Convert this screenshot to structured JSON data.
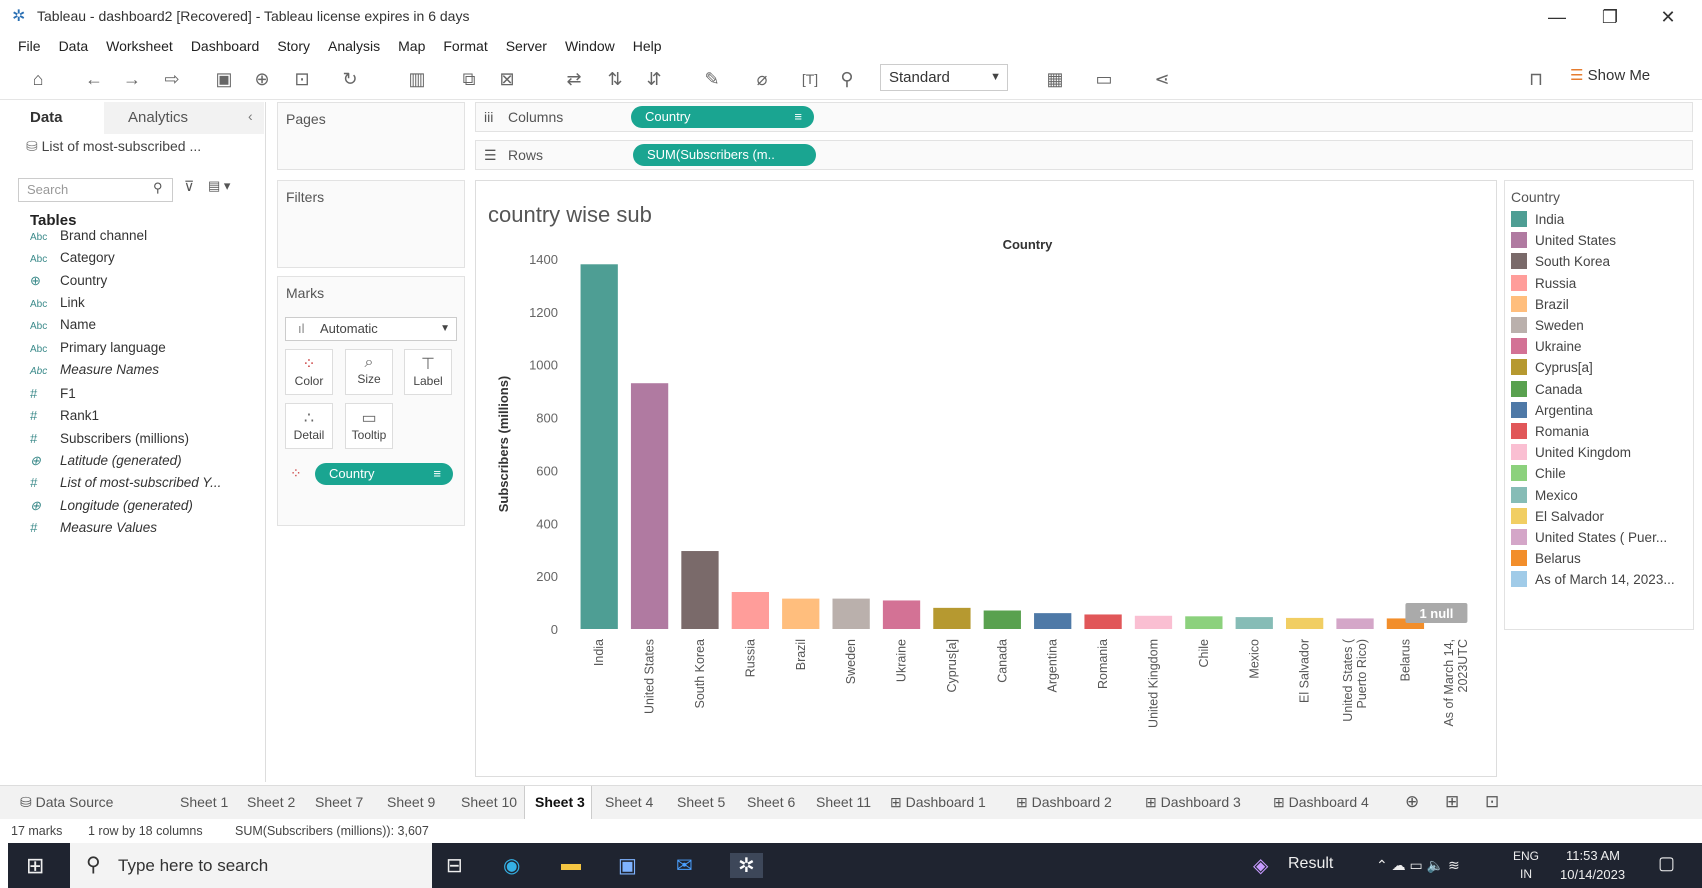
{
  "window": {
    "title": "Tableau - dashboard2 [Recovered] - Tableau license expires in 6 days"
  },
  "menu": [
    "File",
    "Data",
    "Worksheet",
    "Dashboard",
    "Story",
    "Analysis",
    "Map",
    "Format",
    "Server",
    "Window",
    "Help"
  ],
  "toolbar": {
    "fit": "Standard",
    "show_me": "Show Me"
  },
  "datapane": {
    "tab_data": "Data",
    "tab_analytics": "Analytics",
    "source": "List of most-subscribed ...",
    "search_placeholder": "Search",
    "tables_heading": "Tables",
    "fields": [
      {
        "ic": "Abc",
        "name": "Brand channel",
        "it": false
      },
      {
        "ic": "Abc",
        "name": "Category",
        "it": false
      },
      {
        "ic": "⊕",
        "name": "Country",
        "it": false
      },
      {
        "ic": "Abc",
        "name": "Link",
        "it": false
      },
      {
        "ic": "Abc",
        "name": "Name",
        "it": false
      },
      {
        "ic": "Abc",
        "name": "Primary language",
        "it": false
      },
      {
        "ic": "Abc",
        "name": "Measure Names",
        "it": true
      },
      {
        "ic": "#",
        "name": "F1",
        "it": false
      },
      {
        "ic": "#",
        "name": "Rank1",
        "it": false
      },
      {
        "ic": "#",
        "name": "Subscribers (millions)",
        "it": false
      },
      {
        "ic": "⊕",
        "name": "Latitude (generated)",
        "it": true
      },
      {
        "ic": "#",
        "name": "List of most-subscribed Y...",
        "it": true
      },
      {
        "ic": "⊕",
        "name": "Longitude (generated)",
        "it": true
      },
      {
        "ic": "#",
        "name": "Measure Values",
        "it": true
      }
    ]
  },
  "shelves": {
    "pages": "Pages",
    "filters": "Filters",
    "marks": "Marks",
    "mark_type": "Automatic",
    "btn_color": "Color",
    "btn_size": "Size",
    "btn_label": "Label",
    "btn_detail": "Detail",
    "btn_tooltip": "Tooltip",
    "marks_pill": "Country",
    "columns_label": "Columns",
    "rows_label": "Rows",
    "columns_pill": "Country",
    "rows_pill": "SUM(Subscribers (m.."
  },
  "chart_data": {
    "type": "bar",
    "title": "country wise sub",
    "xlabel": "Country",
    "ylabel": "Subscribers (millions)",
    "ylim": [
      0,
      1400
    ],
    "yticks": [
      0,
      200,
      400,
      600,
      800,
      1000,
      1200,
      1400
    ],
    "categories": [
      "India",
      "United States",
      "South Korea",
      "Russia",
      "Brazil",
      "Sweden",
      "Ukraine",
      "Cyprus[a]",
      "Canada",
      "Argentina",
      "Romania",
      "United Kingdom",
      "Chile",
      "Mexico",
      "El Salvador",
      "United States (\nPuerto Rico)",
      "Belarus",
      "As of March 14,\n2023UTC"
    ],
    "values": [
      1380,
      930,
      295,
      140,
      115,
      115,
      108,
      80,
      70,
      60,
      55,
      50,
      48,
      45,
      42,
      40,
      40,
      0
    ],
    "colors": [
      "#4e9e94",
      "#b07aa1",
      "#7a6a6a",
      "#ff9d9a",
      "#ffbe7d",
      "#bab0ac",
      "#d37295",
      "#b69930",
      "#59a14f",
      "#4e79a7",
      "#e15759",
      "#fabfd2",
      "#8cd17d",
      "#86bcb6",
      "#f1ce63",
      "#d4a6c8",
      "#f28e2b",
      "#a0cbe8"
    ],
    "null_badge": "1 null"
  },
  "legend": {
    "title": "Country",
    "items": [
      "India",
      "United States",
      "South Korea",
      "Russia",
      "Brazil",
      "Sweden",
      "Ukraine",
      "Cyprus[a]",
      "Canada",
      "Argentina",
      "Romania",
      "United Kingdom",
      "Chile",
      "Mexico",
      "El Salvador",
      "United States ( Puer...",
      "Belarus",
      "As of March 14, 2023..."
    ]
  },
  "sheets": [
    "Data Source",
    "Sheet 1",
    "Sheet 2",
    "Sheet 7",
    "Sheet 9",
    "Sheet 10",
    "Sheet 3",
    "Sheet 4",
    "Sheet 5",
    "Sheet 6",
    "Sheet 11",
    "Dashboard 1",
    "Dashboard 2",
    "Dashboard 3",
    "Dashboard 4"
  ],
  "active_sheet": "Sheet 3",
  "status": {
    "marks": "17 marks",
    "dims": "1 row by 18 columns",
    "sum": "SUM(Subscribers (millions)): 3,607"
  },
  "taskbar": {
    "search": "Type here to search",
    "result": "Result",
    "lang": "ENG",
    "region": "IN",
    "time": "11:53 AM",
    "date": "10/14/2023"
  }
}
